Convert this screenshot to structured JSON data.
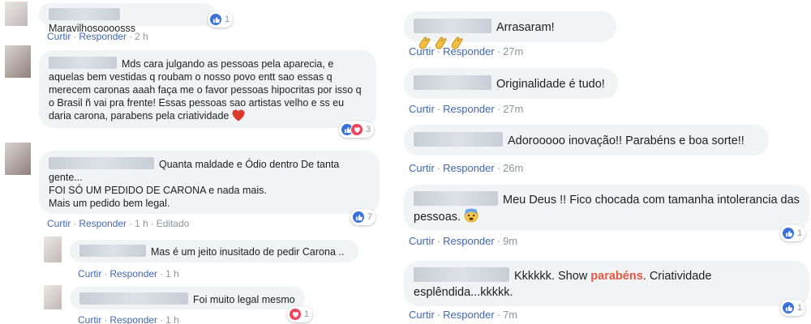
{
  "actions": {
    "like": "Curtir",
    "reply": "Responder",
    "separator": "·"
  },
  "left_comments": [
    {
      "text": "Maravilhosoooosss",
      "time": "2 h",
      "reaction_count": "1"
    },
    {
      "text": "Mds cara julgando as pessoas pela aparecia, e aquelas bem vestidas q roubam o nosso povo entt sao essas q merecem caronas aaah faça me o favor pessoas hipocritas por isso q o Brasil ñ vai pra frente! Essas pessoas sao artistas velho e ss eu daria carona, parabens pela criatividade",
      "reaction_count": "3"
    },
    {
      "lines": [
        "Quanta maldade e Ódio dentro De tanta gente...",
        "FOI SÓ UM PEDIDO DE CARONA e nada mais.",
        "Mais um pedido bem legal."
      ],
      "time": "1 h",
      "edited": "Editado",
      "reaction_count": "7"
    },
    {
      "text": "Mas é um jeito inusitado de pedir Carona ..",
      "time": "1 h"
    },
    {
      "text": "Foi muito legal mesmo",
      "time": "1 h",
      "reaction_count": "1"
    }
  ],
  "right_comments": [
    {
      "text": "Arrasaram!",
      "time": "27m"
    },
    {
      "text": "Originalidade é tudo!",
      "time": "27m"
    },
    {
      "text": "Adorooooo inovação!! Parabéns e boa sorte!!",
      "time": "26m"
    },
    {
      "text": "Meu Deus !! Fico chocada com tamanha intolerancia das pessoas.",
      "time": "9m",
      "reaction_count": "1"
    },
    {
      "text_before": "Kkkkkk. Show",
      "text_emph": "parabéns",
      "text_after": ". Criatividade esplêndida...kkkkk.",
      "time": "7m",
      "reaction_count": "1"
    }
  ],
  "colors": {
    "bubble": "#f2f3f5",
    "link": "#4267b2",
    "meta": "#90949c",
    "like_reaction": "#3b6fdb",
    "love_reaction": "#f0445c",
    "heart_emoji": "#d93a2b",
    "emphasis": "#e9573f"
  },
  "icons": [
    "like-reaction-icon",
    "love-reaction-icon",
    "red-heart-emoji",
    "clapping-hands-emoji",
    "anxious-face-emoji"
  ]
}
